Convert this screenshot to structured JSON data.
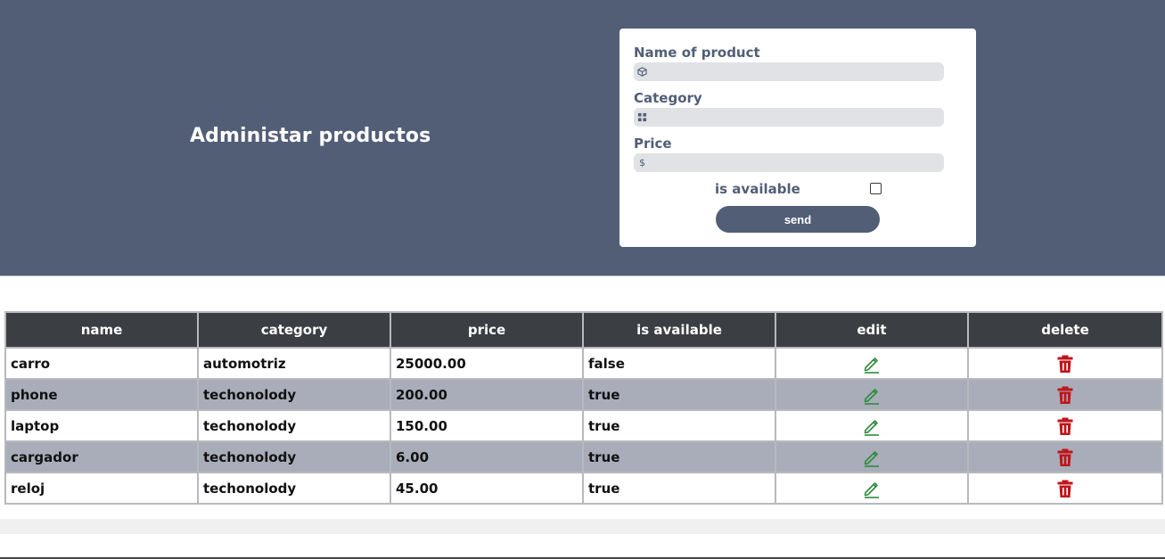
{
  "header": {
    "title": "Administar productos"
  },
  "form": {
    "name_label": "Name of product",
    "name_icon": "box-icon",
    "category_label": "Category",
    "category_icon": "grid-icon",
    "price_label": "Price",
    "price_icon": "dollar-icon",
    "price_icon_glyph": "$",
    "available_label": "is available",
    "available_checked": false,
    "send_label": "send"
  },
  "table": {
    "columns": [
      "name",
      "category",
      "price",
      "is available",
      "edit",
      "delete"
    ],
    "rows": [
      {
        "name": "carro",
        "category": "automotriz",
        "price": "25000.00",
        "available": "false"
      },
      {
        "name": "phone",
        "category": "techonolody",
        "price": "200.00",
        "available": "true"
      },
      {
        "name": "laptop",
        "category": "techonolody",
        "price": "150.00",
        "available": "true"
      },
      {
        "name": "cargador",
        "category": "techonolody",
        "price": "6.00",
        "available": "true"
      },
      {
        "name": "reloj",
        "category": "techonolody",
        "price": "45.00",
        "available": "true"
      }
    ]
  },
  "colors": {
    "header_bg": "#525e76",
    "table_header_bg": "#3b3e42",
    "row_alt_bg": "#a8adb9",
    "edit_icon": "#2e8b3e",
    "delete_icon": "#c0151b"
  }
}
